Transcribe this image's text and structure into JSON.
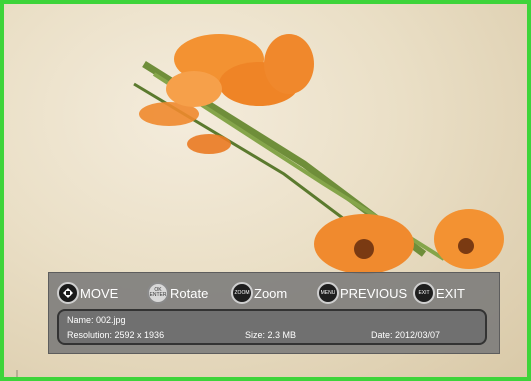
{
  "controls": {
    "move": "MOVE",
    "rotate": "Rotate",
    "rotate_icon_top": "OK",
    "rotate_icon_bottom": "ENTER",
    "zoom": "Zoom",
    "zoom_icon": "ZOOM",
    "previous": "PREVIOUS",
    "previous_icon": "MENU",
    "exit": "EXIT",
    "exit_icon": "EXIT"
  },
  "info": {
    "name": "Name: 002.jpg",
    "resolution": "Resolution: 2592 x 1936",
    "size": "Size: 2.3 MB",
    "date": "Date: 2012/03/07"
  },
  "colors": {
    "frame_border": "#3ed43a",
    "bar_bg": "#787878",
    "flower": "#f08a2e"
  },
  "icons": [
    "dpad-icon",
    "ok-enter-icon",
    "zoom-icon",
    "menu-icon",
    "exit-icon"
  ]
}
